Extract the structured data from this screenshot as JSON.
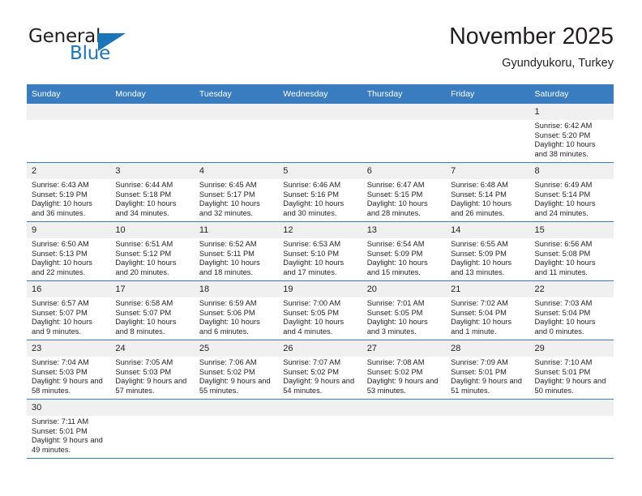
{
  "brand": {
    "name_top": "General",
    "name_bottom": "Blue",
    "accent_color": "#1b75bb",
    "triangle_icon": "brand-triangle-icon"
  },
  "header": {
    "month_title": "November 2025",
    "location": "Gyundyukoru, Turkey"
  },
  "theme": {
    "header_blue": "#3a7cc0",
    "daynum_gray": "#f0f0f0",
    "text": "#231f20"
  },
  "weekdays": [
    "Sunday",
    "Monday",
    "Tuesday",
    "Wednesday",
    "Thursday",
    "Friday",
    "Saturday"
  ],
  "labels": {
    "sunrise": "Sunrise:",
    "sunset": "Sunset:",
    "daylight": "Daylight:"
  },
  "weeks": [
    [
      {
        "day": "",
        "sunrise": "",
        "sunset": "",
        "daylight": "",
        "empty": true
      },
      {
        "day": "",
        "sunrise": "",
        "sunset": "",
        "daylight": "",
        "empty": true
      },
      {
        "day": "",
        "sunrise": "",
        "sunset": "",
        "daylight": "",
        "empty": true
      },
      {
        "day": "",
        "sunrise": "",
        "sunset": "",
        "daylight": "",
        "empty": true
      },
      {
        "day": "",
        "sunrise": "",
        "sunset": "",
        "daylight": "",
        "empty": true
      },
      {
        "day": "",
        "sunrise": "",
        "sunset": "",
        "daylight": "",
        "empty": true
      },
      {
        "day": "1",
        "sunrise": "Sunrise: 6:42 AM",
        "sunset": "Sunset: 5:20 PM",
        "daylight": "Daylight: 10 hours and 38 minutes."
      }
    ],
    [
      {
        "day": "2",
        "sunrise": "Sunrise: 6:43 AM",
        "sunset": "Sunset: 5:19 PM",
        "daylight": "Daylight: 10 hours and 36 minutes."
      },
      {
        "day": "3",
        "sunrise": "Sunrise: 6:44 AM",
        "sunset": "Sunset: 5:18 PM",
        "daylight": "Daylight: 10 hours and 34 minutes."
      },
      {
        "day": "4",
        "sunrise": "Sunrise: 6:45 AM",
        "sunset": "Sunset: 5:17 PM",
        "daylight": "Daylight: 10 hours and 32 minutes."
      },
      {
        "day": "5",
        "sunrise": "Sunrise: 6:46 AM",
        "sunset": "Sunset: 5:16 PM",
        "daylight": "Daylight: 10 hours and 30 minutes."
      },
      {
        "day": "6",
        "sunrise": "Sunrise: 6:47 AM",
        "sunset": "Sunset: 5:15 PM",
        "daylight": "Daylight: 10 hours and 28 minutes."
      },
      {
        "day": "7",
        "sunrise": "Sunrise: 6:48 AM",
        "sunset": "Sunset: 5:14 PM",
        "daylight": "Daylight: 10 hours and 26 minutes."
      },
      {
        "day": "8",
        "sunrise": "Sunrise: 6:49 AM",
        "sunset": "Sunset: 5:14 PM",
        "daylight": "Daylight: 10 hours and 24 minutes."
      }
    ],
    [
      {
        "day": "9",
        "sunrise": "Sunrise: 6:50 AM",
        "sunset": "Sunset: 5:13 PM",
        "daylight": "Daylight: 10 hours and 22 minutes."
      },
      {
        "day": "10",
        "sunrise": "Sunrise: 6:51 AM",
        "sunset": "Sunset: 5:12 PM",
        "daylight": "Daylight: 10 hours and 20 minutes."
      },
      {
        "day": "11",
        "sunrise": "Sunrise: 6:52 AM",
        "sunset": "Sunset: 5:11 PM",
        "daylight": "Daylight: 10 hours and 18 minutes."
      },
      {
        "day": "12",
        "sunrise": "Sunrise: 6:53 AM",
        "sunset": "Sunset: 5:10 PM",
        "daylight": "Daylight: 10 hours and 17 minutes."
      },
      {
        "day": "13",
        "sunrise": "Sunrise: 6:54 AM",
        "sunset": "Sunset: 5:09 PM",
        "daylight": "Daylight: 10 hours and 15 minutes."
      },
      {
        "day": "14",
        "sunrise": "Sunrise: 6:55 AM",
        "sunset": "Sunset: 5:09 PM",
        "daylight": "Daylight: 10 hours and 13 minutes."
      },
      {
        "day": "15",
        "sunrise": "Sunrise: 6:56 AM",
        "sunset": "Sunset: 5:08 PM",
        "daylight": "Daylight: 10 hours and 11 minutes."
      }
    ],
    [
      {
        "day": "16",
        "sunrise": "Sunrise: 6:57 AM",
        "sunset": "Sunset: 5:07 PM",
        "daylight": "Daylight: 10 hours and 9 minutes."
      },
      {
        "day": "17",
        "sunrise": "Sunrise: 6:58 AM",
        "sunset": "Sunset: 5:07 PM",
        "daylight": "Daylight: 10 hours and 8 minutes."
      },
      {
        "day": "18",
        "sunrise": "Sunrise: 6:59 AM",
        "sunset": "Sunset: 5:06 PM",
        "daylight": "Daylight: 10 hours and 6 minutes."
      },
      {
        "day": "19",
        "sunrise": "Sunrise: 7:00 AM",
        "sunset": "Sunset: 5:05 PM",
        "daylight": "Daylight: 10 hours and 4 minutes."
      },
      {
        "day": "20",
        "sunrise": "Sunrise: 7:01 AM",
        "sunset": "Sunset: 5:05 PM",
        "daylight": "Daylight: 10 hours and 3 minutes."
      },
      {
        "day": "21",
        "sunrise": "Sunrise: 7:02 AM",
        "sunset": "Sunset: 5:04 PM",
        "daylight": "Daylight: 10 hours and 1 minute."
      },
      {
        "day": "22",
        "sunrise": "Sunrise: 7:03 AM",
        "sunset": "Sunset: 5:04 PM",
        "daylight": "Daylight: 10 hours and 0 minutes."
      }
    ],
    [
      {
        "day": "23",
        "sunrise": "Sunrise: 7:04 AM",
        "sunset": "Sunset: 5:03 PM",
        "daylight": "Daylight: 9 hours and 58 minutes."
      },
      {
        "day": "24",
        "sunrise": "Sunrise: 7:05 AM",
        "sunset": "Sunset: 5:03 PM",
        "daylight": "Daylight: 9 hours and 57 minutes."
      },
      {
        "day": "25",
        "sunrise": "Sunrise: 7:06 AM",
        "sunset": "Sunset: 5:02 PM",
        "daylight": "Daylight: 9 hours and 55 minutes."
      },
      {
        "day": "26",
        "sunrise": "Sunrise: 7:07 AM",
        "sunset": "Sunset: 5:02 PM",
        "daylight": "Daylight: 9 hours and 54 minutes."
      },
      {
        "day": "27",
        "sunrise": "Sunrise: 7:08 AM",
        "sunset": "Sunset: 5:02 PM",
        "daylight": "Daylight: 9 hours and 53 minutes."
      },
      {
        "day": "28",
        "sunrise": "Sunrise: 7:09 AM",
        "sunset": "Sunset: 5:01 PM",
        "daylight": "Daylight: 9 hours and 51 minutes."
      },
      {
        "day": "29",
        "sunrise": "Sunrise: 7:10 AM",
        "sunset": "Sunset: 5:01 PM",
        "daylight": "Daylight: 9 hours and 50 minutes."
      }
    ],
    [
      {
        "day": "30",
        "sunrise": "Sunrise: 7:11 AM",
        "sunset": "Sunset: 5:01 PM",
        "daylight": "Daylight: 9 hours and 49 minutes."
      },
      {
        "day": "",
        "sunrise": "",
        "sunset": "",
        "daylight": "",
        "empty": true
      },
      {
        "day": "",
        "sunrise": "",
        "sunset": "",
        "daylight": "",
        "empty": true
      },
      {
        "day": "",
        "sunrise": "",
        "sunset": "",
        "daylight": "",
        "empty": true
      },
      {
        "day": "",
        "sunrise": "",
        "sunset": "",
        "daylight": "",
        "empty": true
      },
      {
        "day": "",
        "sunrise": "",
        "sunset": "",
        "daylight": "",
        "empty": true
      },
      {
        "day": "",
        "sunrise": "",
        "sunset": "",
        "daylight": "",
        "empty": true
      }
    ]
  ]
}
